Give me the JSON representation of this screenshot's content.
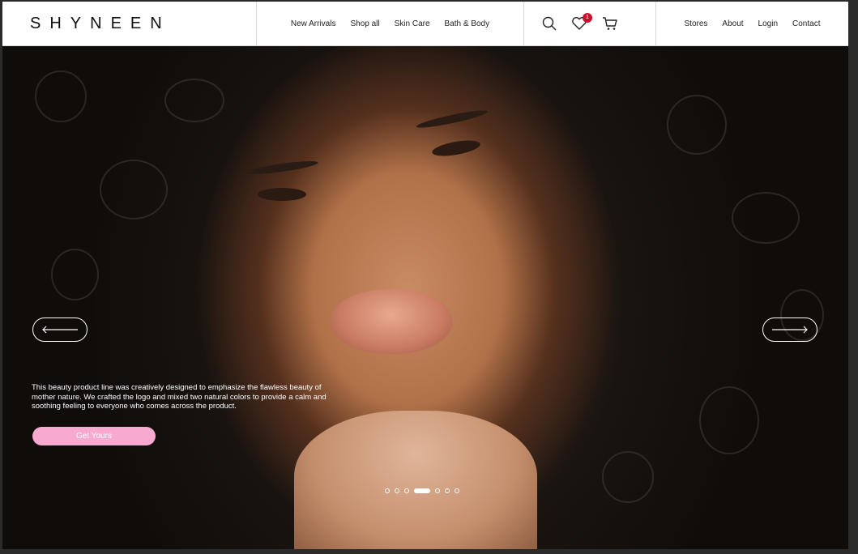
{
  "brand": {
    "logo": "SHYNEEN"
  },
  "nav": {
    "items": [
      {
        "label": "New Arrivals"
      },
      {
        "label": "Shop all"
      },
      {
        "label": "Skin Care"
      },
      {
        "label": "Bath & Body"
      }
    ]
  },
  "icons": {
    "search": "search-icon",
    "wishlist": "heart-icon",
    "wishlist_count": "1",
    "cart": "cart-icon",
    "badge_color": "#c8102e"
  },
  "right_nav": {
    "items": [
      {
        "label": "Stores"
      },
      {
        "label": "About"
      },
      {
        "label": "Login"
      },
      {
        "label": "Contact"
      }
    ]
  },
  "hero": {
    "description": "This beauty product line was creatively designed to emphasize the flawless beauty of mother nature. We crafted the logo and mixed two natural colors to provide a calm and soothing feeling to everyone who comes across the product.",
    "cta_label": "Get Yours",
    "cta_color": "#f7a9d0",
    "prev_icon": "arrow-left-icon",
    "next_icon": "arrow-right-icon",
    "slide_count": 7,
    "active_slide": 4
  }
}
